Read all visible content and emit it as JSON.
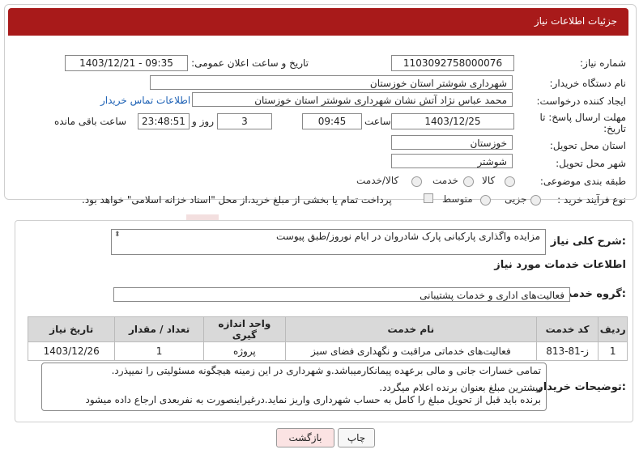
{
  "header": {
    "title": "جزئیات اطلاعات نیاز"
  },
  "form": {
    "need_number_label": "شماره نیاز:",
    "need_number": "1103092758000076",
    "announce_label": "تاریخ و ساعت اعلان عمومی:",
    "announce_value": "1403/12/21 - 09:35",
    "buyer_org_label": "نام دستگاه خریدار:",
    "buyer_org": "شهرداری شوشتر استان خوزستان",
    "creator_label": "ایجاد کننده درخواست:",
    "creator": "محمد عباس نژاد آتش نشان شهرداری شوشتر استان خوزستان",
    "contact_link": "اطلاعات تماس خریدار",
    "deadline_label_1": "مهلت ارسال پاسخ: تا",
    "deadline_label_2": "تاریخ:",
    "deadline_date": "1403/12/25",
    "time_label": "ساعت",
    "deadline_time": "09:45",
    "days_value": "3",
    "days_label": "روز و",
    "remaining_time": "23:48:51",
    "remaining_label": "ساعت باقی مانده",
    "province_label": "استان محل تحویل:",
    "province": "خوزستان",
    "city_label": "شهر محل تحویل:",
    "city": "شوشتر",
    "category_label": "طبقه بندی موضوعی:",
    "category_options": [
      "کالا",
      "خدمت",
      "کالا/خدمت"
    ],
    "purchase_label": "نوع فرآیند خرید :",
    "purchase_options": [
      "جزیی",
      "متوسط"
    ],
    "payment_note": "پرداخت تمام یا بخشی از مبلغ خرید،از محل \"اسناد خزانه اسلامی\" خواهد بود."
  },
  "summary": {
    "label": "شرح کلی نیاز:",
    "text": "مزایده واگذاری پارکبانی پارک شادروان در ایام نوروز/طبق پیوست"
  },
  "services": {
    "section_title": "اطلاعات خدمات مورد نیاز",
    "group_label": "گروه خدمت:",
    "group_value": "فعالیت‌های اداری و خدمات پشتیبانی",
    "columns": [
      "ردیف",
      "کد خدمت",
      "نام خدمت",
      "واحد اندازه گیری",
      "تعداد / مقدار",
      "تاریخ نیاز"
    ],
    "rows": [
      [
        "1",
        "ز-81-813",
        "فعالیت‌های خدماتی مراقبت و نگهداری فضای سبز",
        "پروژه",
        "1",
        "1403/12/26"
      ]
    ]
  },
  "notes": {
    "label": "توضیحات خریدار:",
    "line1": "تمامی خسارات جانی و مالی برعهده پیمانکارمیباشد.و شهرداری در این زمینه هیچگونه مسئولیتی را نمیپذرد.",
    "line2": "بیشترین مبلغ بعنوان برنده اعلام میگردد.",
    "line3": "برنده باید قبل از تحویل مبلغ را کامل به حساب شهرداری واریز نماید.درغیراینصورت به نفربعدی ارجاع داده میشود"
  },
  "buttons": {
    "print": "چاپ",
    "back": "بازگشت"
  },
  "watermark": "AriaTender.neT",
  "colors": {
    "header": "#a81a1a",
    "link": "#1a5fb4",
    "watermark": "#b22222"
  }
}
